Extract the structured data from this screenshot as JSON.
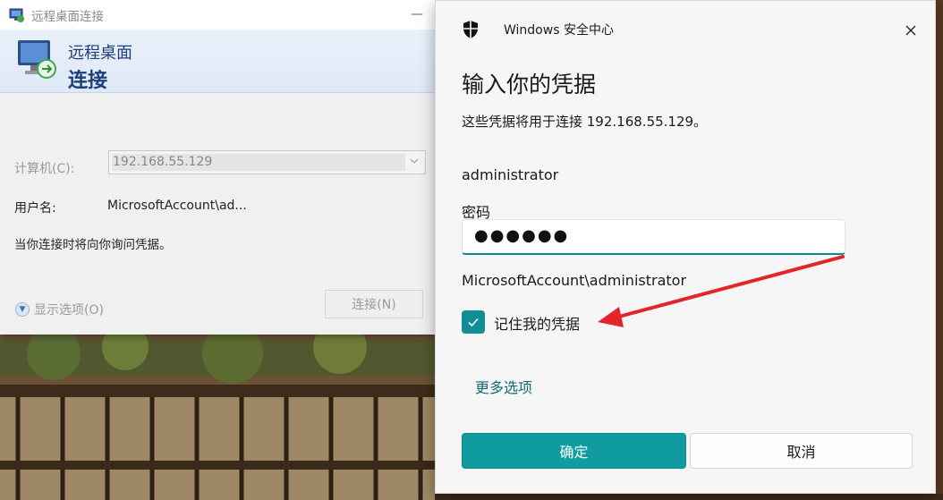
{
  "rdp": {
    "title": "远程桌面连接",
    "banner_line1": "远程桌面",
    "banner_line2": "连接",
    "computer_label": "计算机(C):",
    "computer_value": "192.168.55.129",
    "username_label": "用户名:",
    "username_value": "MicrosoftAccount\\ad...",
    "prompt_note": "当你连接时将向你询问凭据。",
    "show_options": "显示选项(O)",
    "connect_button": "连接(N)",
    "minimize_glyph": "—"
  },
  "security": {
    "app_title": "Windows 安全中心",
    "heading": "输入你的凭据",
    "description": "这些凭据将用于连接 192.168.55.129。",
    "username": "administrator",
    "password_label": "密码",
    "password_value": "●●●●●●",
    "account": "MicrosoftAccount\\administrator",
    "remember_label": "记住我的凭据",
    "remember_checked": true,
    "more_options": "更多选项",
    "ok_button": "确定",
    "cancel_button": "取消"
  },
  "colors": {
    "accent": "#109ba1",
    "link": "#0f6c74",
    "annotation_arrow": "#e4232b",
    "rdp_banner_text": "#1d3f7a"
  },
  "icons": [
    "rdp-app-icon",
    "rdp-monitor-icon",
    "shield-icon",
    "close-icon",
    "checkmark-icon",
    "chevron-down-icon",
    "expand-options-icon"
  ]
}
